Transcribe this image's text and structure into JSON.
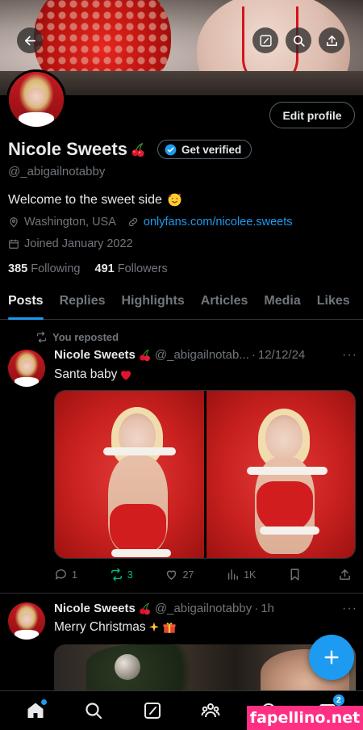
{
  "header": {
    "back_icon": "arrow-left-icon",
    "compose_icon": "compose-icon",
    "search_icon": "search-icon",
    "share_icon": "share-icon"
  },
  "profile": {
    "edit_profile_label": "Edit profile",
    "display_name": "Nicole Sweets",
    "name_emoji": "cherries",
    "get_verified_label": "Get verified",
    "handle": "@_abigailnotabby",
    "bio": "Welcome to the sweet side",
    "bio_emoji": "smiling-face-with-hearts",
    "location": "Washington, USA",
    "website": "onlyfans.com/nicolee.sweets",
    "joined": "Joined January 2022",
    "following_count": "385",
    "following_label": "Following",
    "followers_count": "491",
    "followers_label": "Followers"
  },
  "tabs": [
    {
      "label": "Posts",
      "active": true
    },
    {
      "label": "Replies",
      "active": false
    },
    {
      "label": "Highlights",
      "active": false
    },
    {
      "label": "Articles",
      "active": false
    },
    {
      "label": "Media",
      "active": false
    },
    {
      "label": "Likes",
      "active": false
    }
  ],
  "posts": [
    {
      "repost_label": "You reposted",
      "author": "Nicole Sweets",
      "handle": "@_abigailnotab...",
      "date": "12/12/24",
      "more": "···",
      "text": "Santa baby",
      "text_emoji": "red-heart",
      "actions": {
        "replies": "1",
        "reposts": "3",
        "likes": "27",
        "views": "1K"
      }
    },
    {
      "author": "Nicole Sweets",
      "handle": "@_abigailnotabby",
      "date": "1h",
      "more": "···",
      "text": "Merry Christmas",
      "text_emoji": "sparkles-gift"
    }
  ],
  "bottom_nav": {
    "items": [
      "home-icon",
      "search-icon",
      "compose-icon",
      "communities-icon",
      "grok-icon",
      "messages-icon"
    ],
    "messages_badge": "2"
  },
  "colors": {
    "accent": "#1d9bf0",
    "repost_green": "#00ba7c",
    "muted": "#71767b"
  },
  "watermark": "fapellino.net"
}
